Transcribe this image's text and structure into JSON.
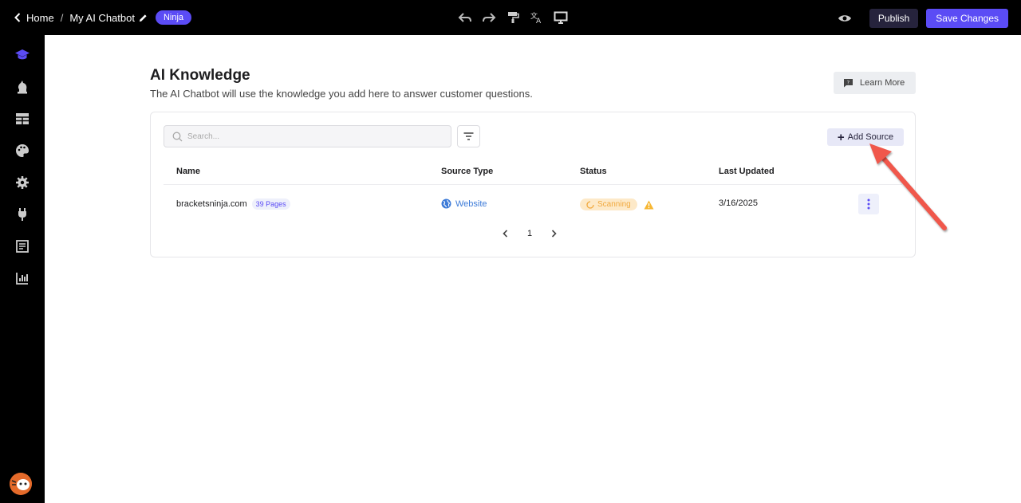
{
  "header": {
    "back_label": "Home",
    "separator": "/",
    "bot_name": "My AI Chatbot",
    "plan_badge": "Ninja",
    "publish_label": "Publish",
    "save_label": "Save Changes",
    "accent": "#5b4cf5"
  },
  "toolbar_icons": [
    "undo-icon",
    "redo-icon",
    "paint-roller-icon",
    "translate-icon",
    "monitor-icon"
  ],
  "sidebar": {
    "items": [
      "graduation-cap-icon",
      "chess-knight-icon",
      "table-icon",
      "palette-icon",
      "gear-icon",
      "plug-icon",
      "form-icon",
      "bar-chart-icon"
    ],
    "active_index": 0
  },
  "main": {
    "title": "AI Knowledge",
    "subtitle": "The AI Chatbot will use the knowledge you add here to answer customer questions.",
    "learn_more_label": "Learn More",
    "search_placeholder": "Search...",
    "add_source_label": "Add Source",
    "columns": [
      "Name",
      "Source Type",
      "Status",
      "Last Updated"
    ],
    "rows": [
      {
        "name": "bracketsninja.com",
        "pages_badge": "39 Pages",
        "source_type": "Website",
        "status": "Scanning",
        "last_updated": "3/16/2025"
      }
    ],
    "pagination": {
      "current_page": "1"
    }
  }
}
